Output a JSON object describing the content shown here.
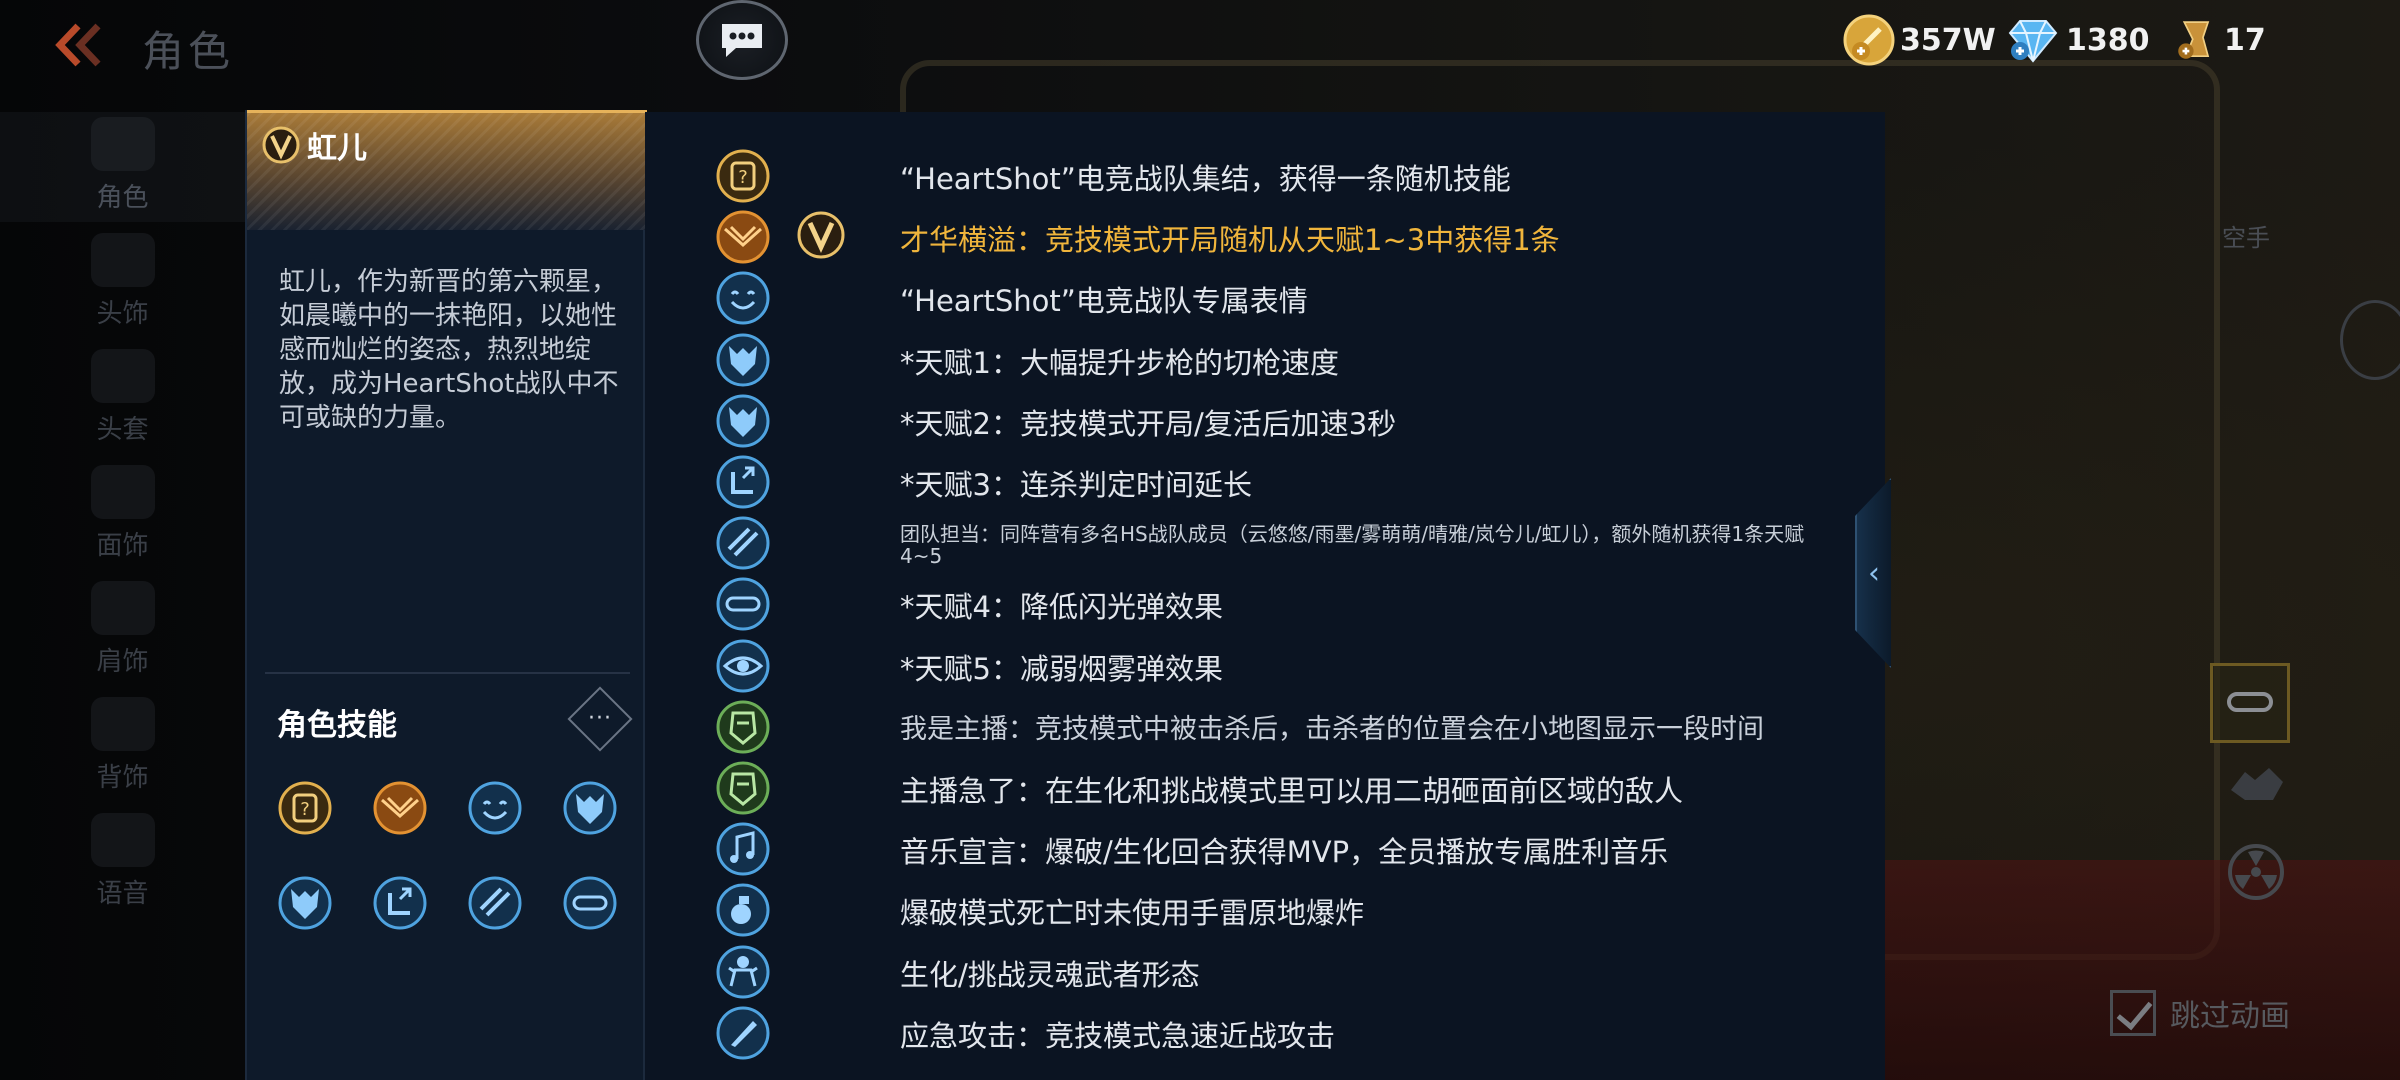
{
  "header": {
    "page_title": "角色",
    "icons": {
      "back": "double-chevron-left-icon",
      "chat": "chat-bubble-icon"
    }
  },
  "currency": {
    "gold": {
      "value": "357W",
      "icon": "gold-coin-plus-icon"
    },
    "diamond": {
      "value": "1380",
      "icon": "diamond-plus-icon"
    },
    "ticket": {
      "value": "17",
      "icon": "trophy-ticket-plus-icon"
    }
  },
  "left_nav": {
    "items": [
      {
        "label": "角色",
        "active": true
      },
      {
        "label": "头饰"
      },
      {
        "label": "头套"
      },
      {
        "label": "面饰"
      },
      {
        "label": "肩饰"
      },
      {
        "label": "背饰"
      },
      {
        "label": "语音"
      }
    ]
  },
  "character": {
    "name": "虹儿",
    "rank_badge": "V",
    "description": "虹儿，作为新晋的第六颗星，如晨曦中的一抹艳阳，以她性感而灿烂的姿态，热烈地绽放，成为HeartShot战队中不可或缺的力量。",
    "skills_title": "角色技能",
    "more_label": "···",
    "skill_icons": [
      "mystery-skill-icon",
      "phoenix-wings-icon",
      "smile-emote-icon",
      "wolf-head-icon",
      "wolf-head-icon",
      "boot-up-arrow-icon",
      "slash-armor-icon",
      "goggles-icon"
    ]
  },
  "skills_detail": [
    {
      "icon": "mystery-skill-icon",
      "text": "“HeartShot”电竞战队集结，获得一条随机技能",
      "style": "light"
    },
    {
      "icon": "phoenix-wings-icon",
      "badge": "V",
      "text": "才华横溢：竞技模式开局随机从天赋1~3中获得1条",
      "style": "gold"
    },
    {
      "icon": "smile-emote-icon",
      "text": "“HeartShot”电竞战队专属表情",
      "style": "light"
    },
    {
      "icon": "wolf-head-icon",
      "text": "*天赋1：大幅提升步枪的切枪速度",
      "style": "light"
    },
    {
      "icon": "wolf-head-icon",
      "text": "*天赋2：竞技模式开局/复活后加速3秒",
      "style": "light"
    },
    {
      "icon": "boot-up-arrow-icon",
      "text": "*天赋3：连杀判定时间延长",
      "style": "light"
    },
    {
      "icon": "slash-armor-icon",
      "text": "团队担当：同阵营有多名HS战队成员（云悠悠/雨墨/雾萌萌/晴雅/岚兮儿/虹儿），额外随机获得1条天赋4~5",
      "style": "small"
    },
    {
      "icon": "goggles-icon",
      "text": "*天赋4：降低闪光弹效果",
      "style": "light"
    },
    {
      "icon": "eye-shield-icon",
      "text": "*天赋5：减弱烟雾弹效果",
      "style": "light"
    },
    {
      "icon": "streamer-mask-icon",
      "text": "我是主播：竞技模式中被击杀后，击杀者的位置会在小地图显示一段时间",
      "style": "mid"
    },
    {
      "icon": "streamer-mask-icon",
      "text": "主播急了：在生化和挑战模式里可以用二胡砸面前区域的敌人",
      "style": "light"
    },
    {
      "icon": "music-note-icon",
      "text": "音乐宣言：爆破/生化回合获得MVP，全员播放专属胜利音乐",
      "style": "light"
    },
    {
      "icon": "grenade-icon",
      "text": "爆破模式死亡时未使用手雷原地爆炸",
      "style": "light"
    },
    {
      "icon": "soul-warrior-icon",
      "text": "生化/挑战灵魂武者形态",
      "style": "light"
    },
    {
      "icon": "knife-icon",
      "text": "应急攻击：竞技模式急速近战攻击",
      "style": "light"
    }
  ],
  "right_controls": {
    "empty_hand_label": "空手",
    "skip_animation_label": "跳过动画",
    "skip_animation_checked": true,
    "collapse_icon": "chevron-left-icon"
  },
  "colors": {
    "gold_text": "#f0b53c",
    "panel_bg": "#0b1422",
    "accent_blue": "#4fa3e0"
  }
}
